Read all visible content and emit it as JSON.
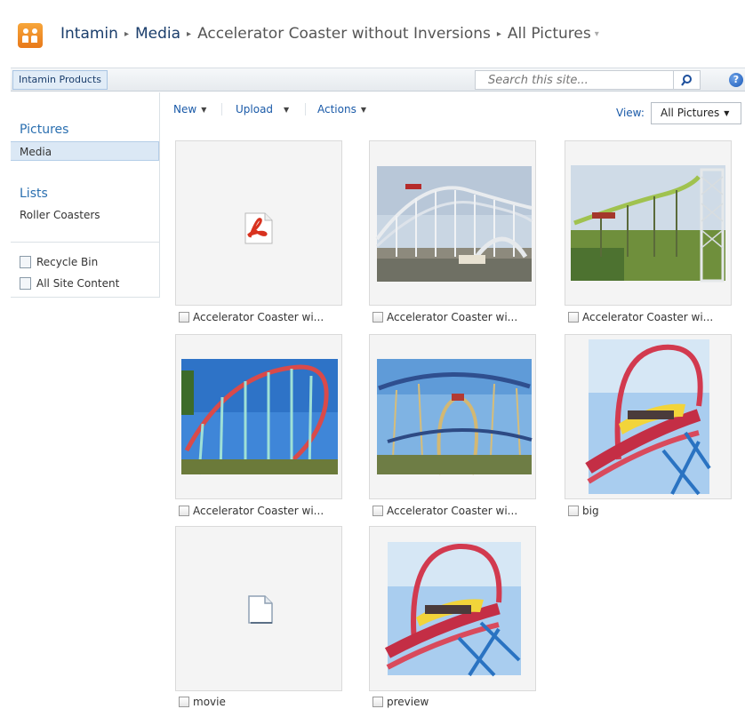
{
  "breadcrumb": {
    "site": "Intamin",
    "library": "Media",
    "folder": "Accelerator Coaster without Inversions",
    "view": "All Pictures"
  },
  "topnav": {
    "tab": "Intamin Products",
    "search_placeholder": "Search this site...",
    "help_icon": "?"
  },
  "leftnav": {
    "pictures_heading": "Pictures",
    "media": "Media",
    "lists_heading": "Lists",
    "roller_coasters": "Roller Coasters",
    "recycle_bin": "Recycle Bin",
    "all_site_content": "All Site Content"
  },
  "toolbar": {
    "new": "New",
    "upload": "Upload",
    "actions": "Actions",
    "view_label": "View:",
    "view_value": "All Pictures"
  },
  "thumbnails": [
    {
      "caption": "Accelerator Coaster wi...",
      "icon": "pdf-icon"
    },
    {
      "caption": "Accelerator Coaster wi...",
      "icon": "coaster-photo"
    },
    {
      "caption": "Accelerator Coaster wi...",
      "icon": "coaster-photo"
    },
    {
      "caption": "Accelerator Coaster wi...",
      "icon": "coaster-photo"
    },
    {
      "caption": "Accelerator Coaster wi...",
      "icon": "coaster-photo"
    },
    {
      "caption": "big",
      "icon": "coaster-photo"
    },
    {
      "caption": "movie",
      "icon": "generic-file-icon"
    },
    {
      "caption": "preview",
      "icon": "coaster-photo"
    }
  ],
  "colors": {
    "link": "#1a5aa8",
    "nav_heading": "#2a6fb0",
    "logo": "#f08c2a",
    "selected": "#dbe8f5"
  }
}
